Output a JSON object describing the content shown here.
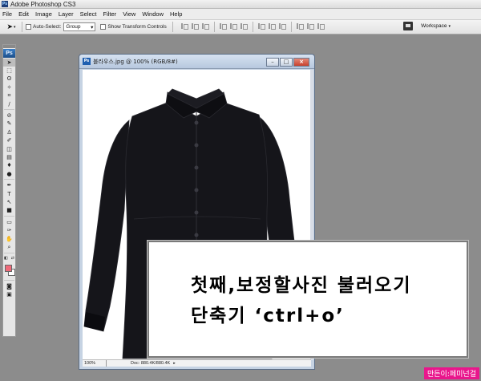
{
  "app": {
    "title": "Adobe Photoshop CS3",
    "icon_text": "Ps"
  },
  "menu": [
    "File",
    "Edit",
    "Image",
    "Layer",
    "Select",
    "Filter",
    "View",
    "Window",
    "Help"
  ],
  "options_bar": {
    "auto_select_label": "Auto-Select:",
    "auto_select_checked": false,
    "auto_select_value": "Group",
    "show_transform_label": "Show Transform Controls",
    "show_transform_checked": false,
    "workspace_label": "Workspace"
  },
  "tools": {
    "logo": "Ps",
    "icons": [
      "move-icon",
      "marquee-icon",
      "lasso-icon",
      "magic-wand-icon",
      "crop-icon",
      "slice-icon",
      "healing-brush-icon",
      "brush-icon",
      "clone-stamp-icon",
      "history-brush-icon",
      "eraser-icon",
      "gradient-icon",
      "blur-icon",
      "dodge-icon",
      "pen-icon",
      "type-icon",
      "path-selection-icon",
      "shape-icon",
      "notes-icon",
      "eyedropper-icon",
      "hand-icon",
      "zoom-icon"
    ],
    "foreground_color": "#f06a7a",
    "background_color": "#ffffff"
  },
  "document": {
    "title": "블라우스.jpg @ 100% (RGB/8#)",
    "zoom": "100%",
    "doc_size": "Doc: 880.4K/880.4K",
    "image_subject": "black long-sleeve button-up shirt"
  },
  "caption": {
    "line1": "첫째,보정할사진 불러오기",
    "line2": "단축기 ‘ctrl+o’"
  },
  "watermark": "만든이:페미넌걸"
}
